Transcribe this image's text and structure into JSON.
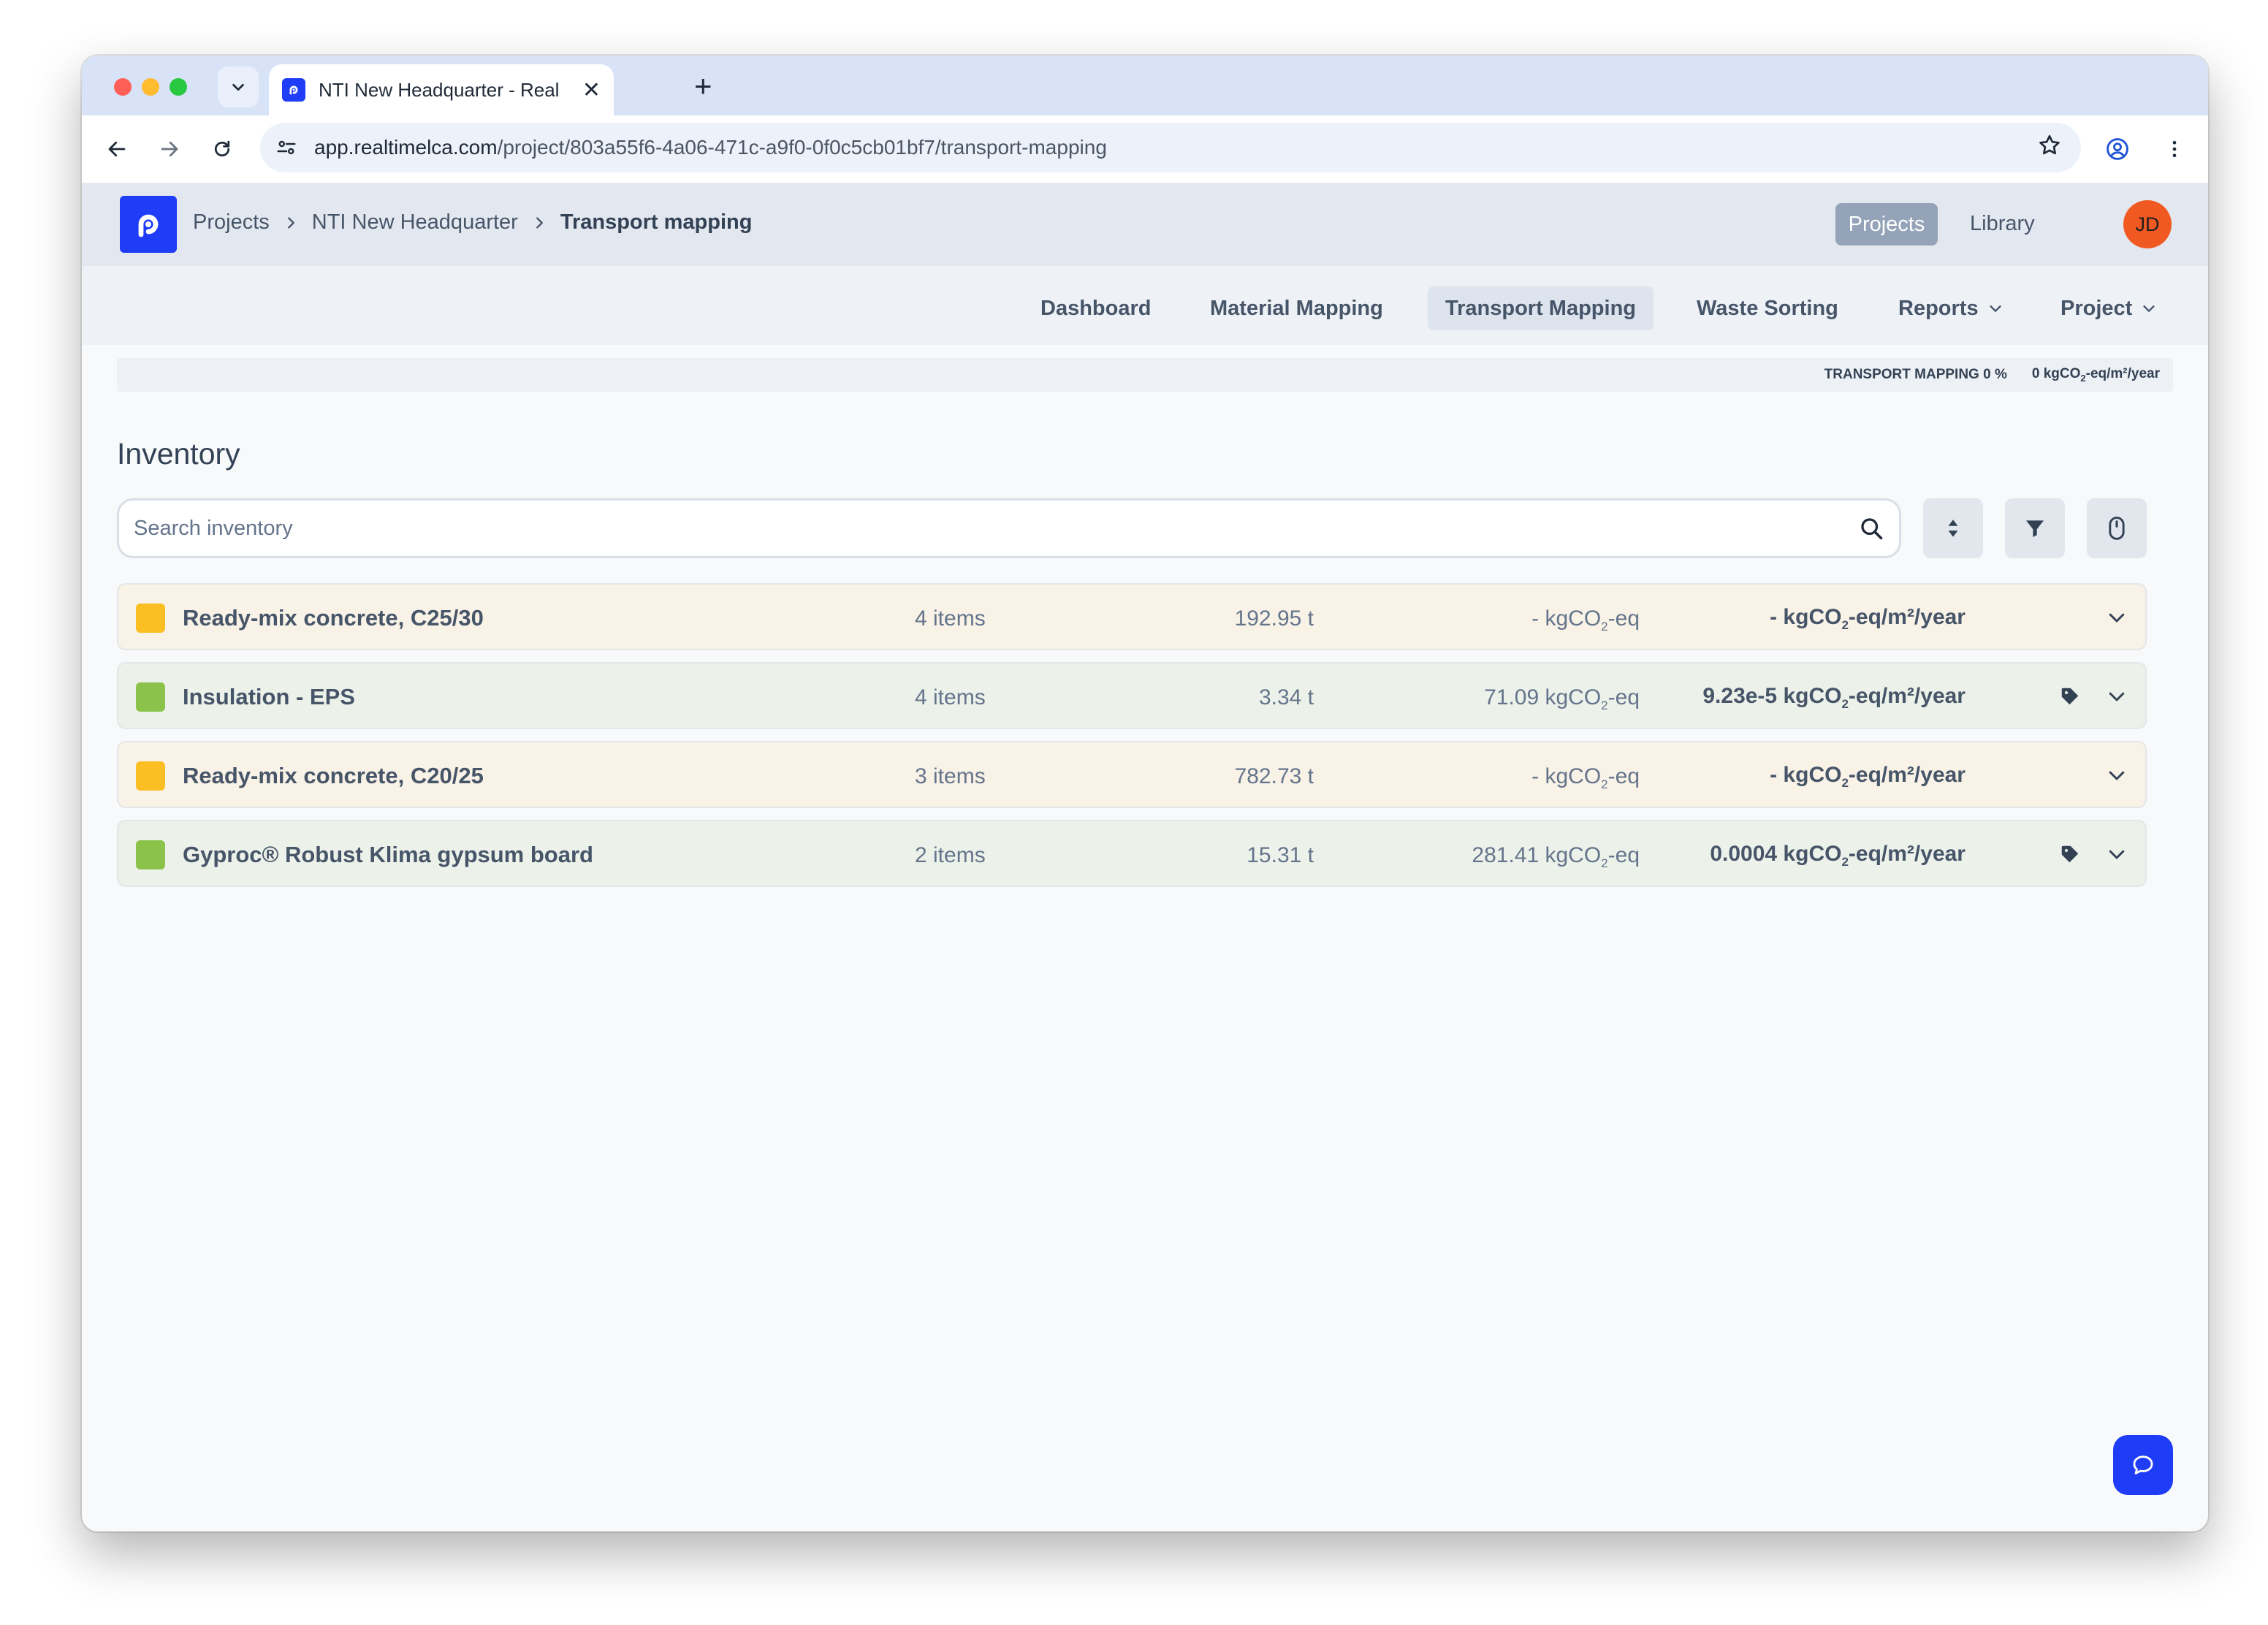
{
  "browser": {
    "tab_title": "NTI New Headquarter - Real-",
    "url_host": "app.realtimelca.com",
    "url_path": "/project/803a55f6-4a06-471c-a9f0-0f0c5cb01bf7/transport-mapping"
  },
  "header": {
    "breadcrumbs": [
      "Projects",
      "NTI New Headquarter",
      "Transport mapping"
    ],
    "projects_label": "Projects",
    "library_label": "Library",
    "avatar_initials": "JD"
  },
  "subnav": {
    "items": [
      "Dashboard",
      "Material Mapping",
      "Transport Mapping",
      "Waste Sorting",
      "Reports",
      "Project"
    ],
    "active": "Transport Mapping"
  },
  "status": {
    "transport_mapping_label": "TRANSPORT MAPPING",
    "transport_mapping_value": "0 %",
    "total_value": "0 kgCO",
    "total_sub": "2",
    "total_unit": "-eq/m²/year"
  },
  "inventory": {
    "title": "Inventory",
    "search_placeholder": "Search inventory",
    "rows": [
      {
        "name": "Ready-mix concrete, C25/30",
        "items": "4 items",
        "weight": "192.95 t",
        "co2_value": "- kgCO",
        "co2_unit": "-eq",
        "co2y_value": "- kgCO",
        "co2y_unit": "-eq/m²/year",
        "color": "#fbbf24",
        "tone": "warm",
        "tag": false
      },
      {
        "name": "Insulation - EPS",
        "items": "4 items",
        "weight": "3.34 t",
        "co2_value": "71.09 kgCO",
        "co2_unit": "-eq",
        "co2y_value": "9.23e-5 kgCO",
        "co2y_unit": "-eq/m²/year",
        "color": "#8bc34a",
        "tone": "green",
        "tag": true
      },
      {
        "name": "Ready-mix concrete, C20/25",
        "items": "3 items",
        "weight": "782.73 t",
        "co2_value": "- kgCO",
        "co2_unit": "-eq",
        "co2y_value": "- kgCO",
        "co2y_unit": "-eq/m²/year",
        "color": "#fbbf24",
        "tone": "warm",
        "tag": false
      },
      {
        "name": "Gyproc® Robust Klima gypsum board",
        "items": "2 items",
        "weight": "15.31 t",
        "co2_value": "281.41 kgCO",
        "co2_unit": "-eq",
        "co2y_value": "0.0004 kgCO",
        "co2y_unit": "-eq/m²/year",
        "color": "#8bc34a",
        "tone": "green",
        "tag": true
      }
    ],
    "subscript": "2"
  },
  "colors": {
    "brand": "#1f3cf7",
    "avatar": "#f05a22",
    "warm_row": "#f8f2e7",
    "green_row": "#ecf1ea"
  },
  "icons": {
    "tab_menu": "chevron-down-icon",
    "back": "arrow-left-icon",
    "forward": "arrow-right-icon",
    "reload": "reload-icon",
    "site_settings": "tune-icon",
    "bookmark": "star-icon",
    "profile": "account-icon",
    "menu": "kebab-icon",
    "sort": "sort-icon",
    "filter": "filter-icon",
    "mouse": "mouse-icon",
    "tag": "tag-icon",
    "expand": "chevron-down-icon",
    "chat": "chat-icon"
  }
}
